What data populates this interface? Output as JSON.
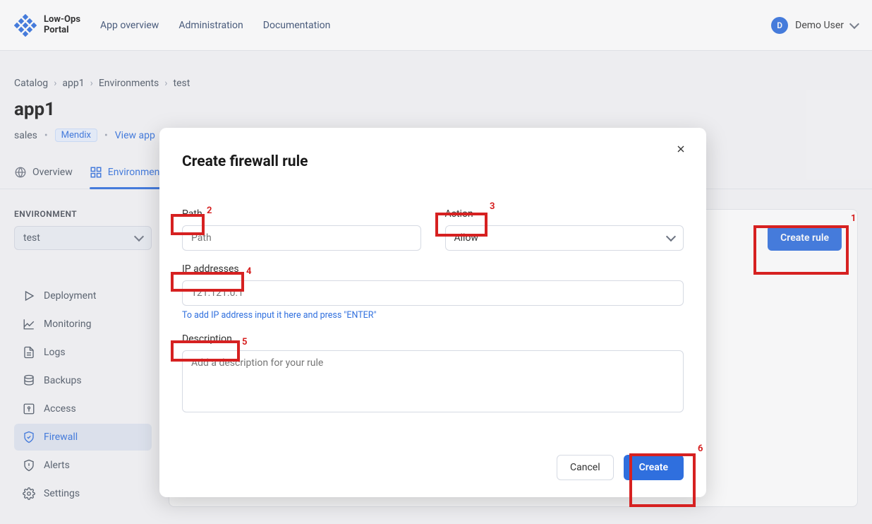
{
  "brand": {
    "line1": "Low-Ops",
    "line2": "Portal"
  },
  "nav": {
    "overview": "App overview",
    "admin": "Administration",
    "docs": "Documentation"
  },
  "user": {
    "initial": "D",
    "name": "Demo User"
  },
  "breadcrumb": {
    "catalog": "Catalog",
    "app": "app1",
    "env": "Environments",
    "leaf": "test"
  },
  "page": {
    "title": "app1",
    "subtitle": "sales",
    "badge": "Mendix",
    "viewApp": "View app"
  },
  "tabs": {
    "overview": "Overview",
    "environments": "Environments"
  },
  "sidebar": {
    "title": "ENVIRONMENT",
    "selected": "test",
    "items": [
      {
        "label": "Deployment"
      },
      {
        "label": "Monitoring"
      },
      {
        "label": "Logs"
      },
      {
        "label": "Backups"
      },
      {
        "label": "Access"
      },
      {
        "label": "Firewall"
      },
      {
        "label": "Alerts"
      },
      {
        "label": "Settings"
      }
    ]
  },
  "main": {
    "createRule": "Create rule"
  },
  "modal": {
    "title": "Create firewall rule",
    "fields": {
      "path": {
        "label": "Path",
        "placeholder": "Path"
      },
      "action": {
        "label": "Action",
        "value": "Allow"
      },
      "ip": {
        "label": "IP addresses",
        "placeholder": "121.121.0.1",
        "help": "To add IP address input it here and press \"ENTER\""
      },
      "description": {
        "label": "Description",
        "placeholder": "Add a description for your rule"
      }
    },
    "cancel": "Cancel",
    "create": "Create"
  },
  "annotations": {
    "1": "1",
    "2": "2",
    "3": "3",
    "4": "4",
    "5": "5",
    "6": "6"
  }
}
